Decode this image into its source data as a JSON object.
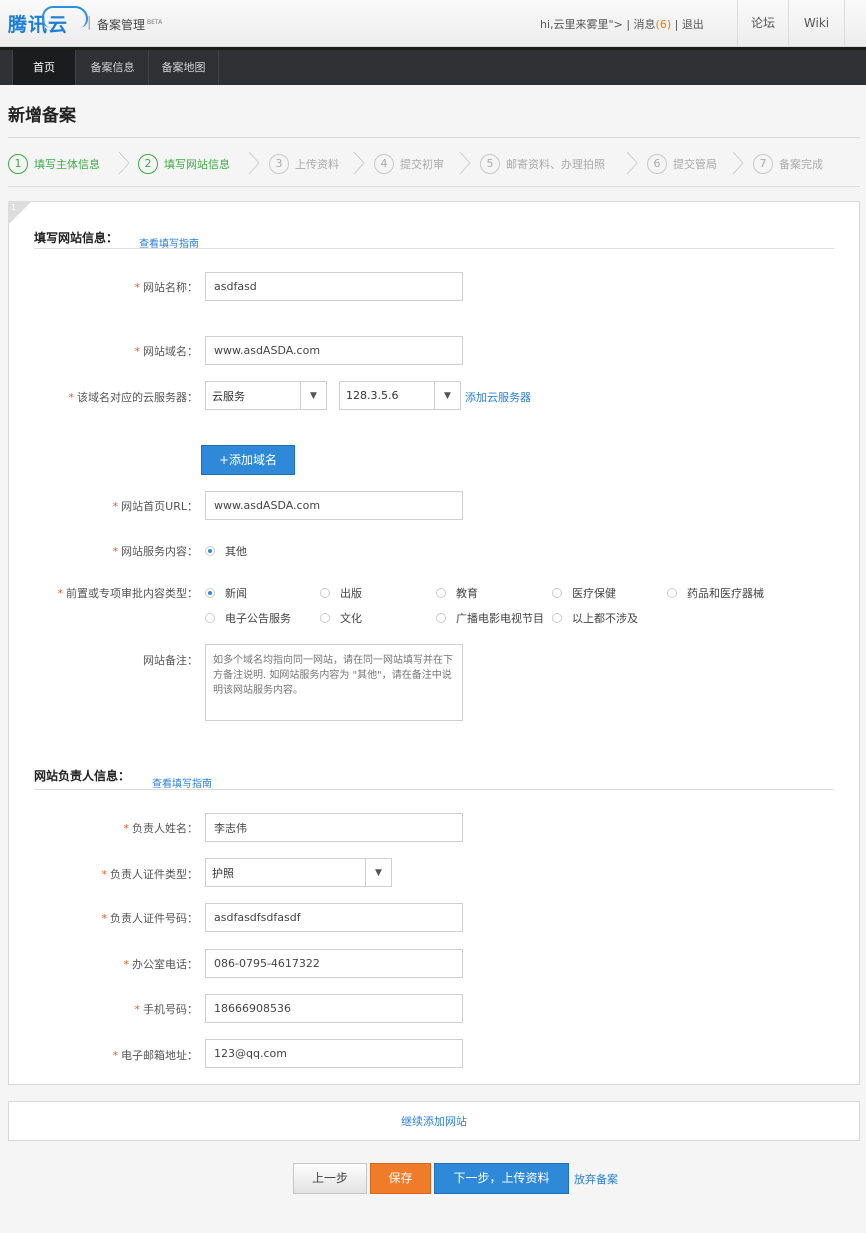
{
  "header": {
    "logo_text": "腾讯云",
    "separator": "|",
    "app_title": "备案管理",
    "app_badge": "BETA",
    "greeting": "hi,云里来雾里\">",
    "messages_label": "消息",
    "messages_count": "6",
    "logout": "退出",
    "forum": "论坛",
    "wiki": "Wiki"
  },
  "nav": {
    "tabs": [
      {
        "label": "首页"
      },
      {
        "label": "备案信息"
      },
      {
        "label": "备案地图"
      }
    ]
  },
  "page": {
    "title": "新增备案"
  },
  "steps": [
    {
      "num": "1",
      "label": "填写主体信息",
      "done": true
    },
    {
      "num": "2",
      "label": "填写网站信息",
      "done": true
    },
    {
      "num": "3",
      "label": "上传资料",
      "done": false
    },
    {
      "num": "4",
      "label": "提交初审",
      "done": false
    },
    {
      "num": "5",
      "label": "邮寄资料、办理拍照",
      "done": false
    },
    {
      "num": "6",
      "label": "提交管局",
      "done": false
    },
    {
      "num": "7",
      "label": "备案完成",
      "done": false
    }
  ],
  "panel": {
    "corner_num": "1"
  },
  "site_section": {
    "heading": "填写网站信息：",
    "guide_link": "查看填写指南",
    "site_name_label": "网站名称：",
    "site_name_value": "asdfasd",
    "domain_label": "网站域名：",
    "domain_value": "www.asdASDA.com",
    "server_label": "该域名对应的云服务器：",
    "server_type_value": "云服务",
    "server_ip_value": "128.3.5.6",
    "add_server_link": "添加云服务器",
    "add_domain_button": "+添加域名",
    "homepage_label": "网站首页URL：",
    "homepage_value": "www.asdASDA.com",
    "service_label": "网站服务内容：",
    "service_option": "其他",
    "approval_label": "前置或专项审批内容类型：",
    "approval_options": [
      "新闻",
      "出版",
      "教育",
      "医疗保健",
      "药品和医疗器械",
      "电子公告服务",
      "文化",
      "广播电影电视节目",
      "以上都不涉及"
    ],
    "remark_label": "网站备注：",
    "remark_placeholder": "如多个域名均指向同一网站，请在同一网站填写并在下方备注说明. 如网站服务内容为 \"其他\"，请在备注中说明该网站服务内容。"
  },
  "owner_section": {
    "heading": "网站负责人信息：",
    "guide_link": "查看填写指南",
    "name_label": "负责人姓名：",
    "name_value": "李志伟",
    "id_type_label": "负责人证件类型：",
    "id_type_value": "护照",
    "id_number_label": "负责人证件号码：",
    "id_number_value": "asdfasdfsdfasdf",
    "office_phone_label": "办公室电话：",
    "office_phone_value": "086-0795-4617322",
    "mobile_label": "手机号码：",
    "mobile_value": "18666908536",
    "email_label": "电子邮箱地址：",
    "email_value": "123@qq.com"
  },
  "footer": {
    "add_more_link": "继续添加网站",
    "prev_button": "上一步",
    "save_button": "保存",
    "next_button": "下一步，上传资料",
    "abandon_link": "放弃备案"
  },
  "colors": {
    "accent_blue": "#2f89d9",
    "step_green": "#3daa45",
    "save_orange": "#f07b29",
    "nav_dark": "#2f3134"
  }
}
